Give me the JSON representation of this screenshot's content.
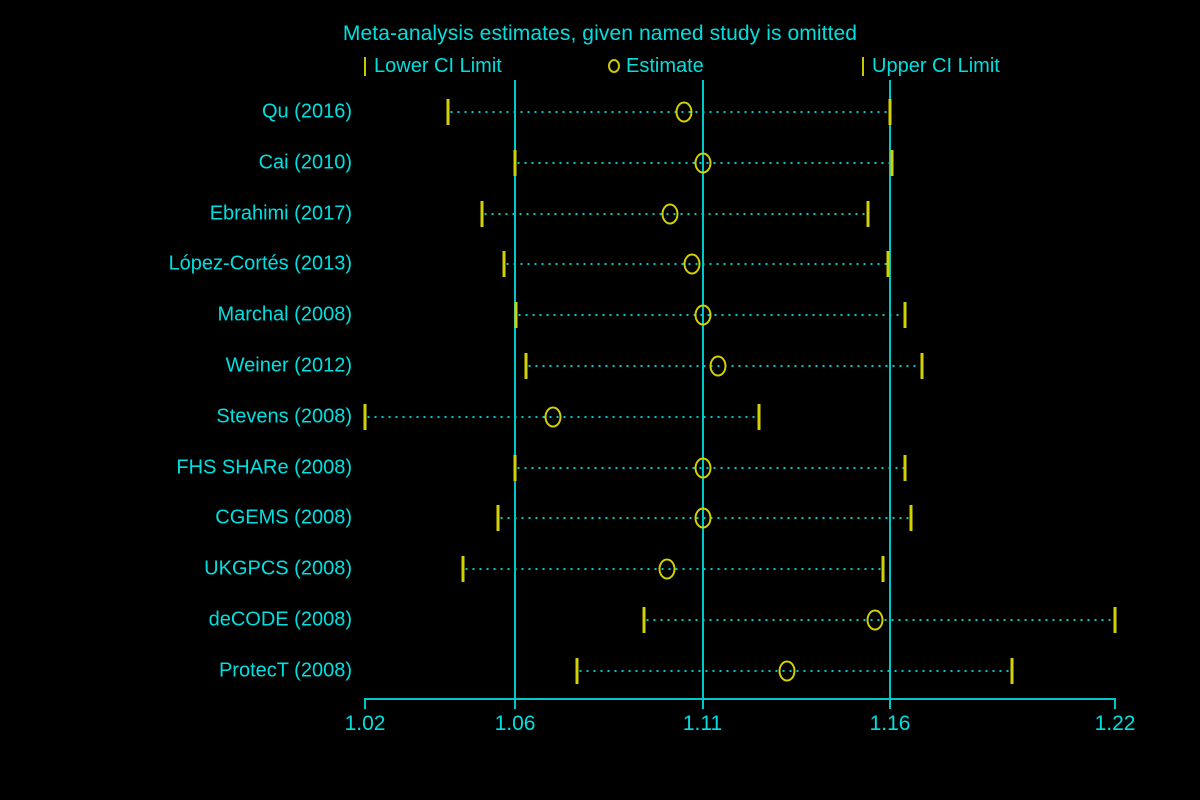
{
  "chart_data": {
    "type": "forest",
    "title": "Meta-analysis estimates, given named study is omitted",
    "xlabel": "",
    "ylabel": "",
    "xlim": [
      1.02,
      1.22
    ],
    "xticks": [
      "1.02",
      "1.06",
      "1.11",
      "1.16",
      "1.22"
    ],
    "xtick_values": [
      1.02,
      1.06,
      1.11,
      1.16,
      1.22
    ],
    "reference_lines": [
      1.06,
      1.11,
      1.16
    ],
    "grid": false,
    "legend_position": "top",
    "legend": [
      {
        "marker": "bar",
        "label": "Lower CI Limit"
      },
      {
        "marker": "circle",
        "label": "Estimate"
      },
      {
        "marker": "bar",
        "label": "Upper CI Limit"
      }
    ],
    "categories": [
      "Qu (2016)",
      "Cai (2010)",
      "Ebrahimi (2017)",
      "López-Cortés (2013)",
      "Marchal (2008)",
      "Weiner (2012)",
      "Stevens (2008)",
      "FHS SHARe (2008)",
      "CGEMS (2008)",
      "UKGPCS (2008)",
      "deCODE (2008)",
      "ProtecT (2008)"
    ],
    "rows": [
      {
        "study": "Qu (2016)",
        "lower": 1.042,
        "estimate": 1.105,
        "upper": 1.16
      },
      {
        "study": "Cai (2010)",
        "lower": 1.06,
        "estimate": 1.11,
        "upper": 1.1605
      },
      {
        "study": "Ebrahimi (2017)",
        "lower": 1.0513,
        "estimate": 1.1013,
        "upper": 1.154
      },
      {
        "study": "López-Cortés (2013)",
        "lower": 1.057,
        "estimate": 1.1072,
        "upper": 1.1595
      },
      {
        "study": "Marchal (2008)",
        "lower": 1.0602,
        "estimate": 1.11,
        "upper": 1.164
      },
      {
        "study": "Weiner (2012)",
        "lower": 1.063,
        "estimate": 1.114,
        "upper": 1.1685
      },
      {
        "study": "Stevens (2008)",
        "lower": 1.02,
        "estimate": 1.07,
        "upper": 1.125
      },
      {
        "study": "FHS SHARe (2008)",
        "lower": 1.06,
        "estimate": 1.11,
        "upper": 1.164
      },
      {
        "study": "CGEMS (2008)",
        "lower": 1.0555,
        "estimate": 1.11,
        "upper": 1.1655
      },
      {
        "study": "UKGPCS (2008)",
        "lower": 1.046,
        "estimate": 1.1005,
        "upper": 1.158
      },
      {
        "study": "deCODE (2008)",
        "lower": 1.0945,
        "estimate": 1.156,
        "upper": 1.22
      },
      {
        "study": "ProtecT (2008)",
        "lower": 1.0765,
        "estimate": 1.1325,
        "upper": 1.1925
      }
    ],
    "colors": {
      "background": "#000000",
      "axis": "#00c8c8",
      "text": "#00e0e0",
      "marker": "#d2d200",
      "ci_line": "#00c8c8"
    }
  }
}
